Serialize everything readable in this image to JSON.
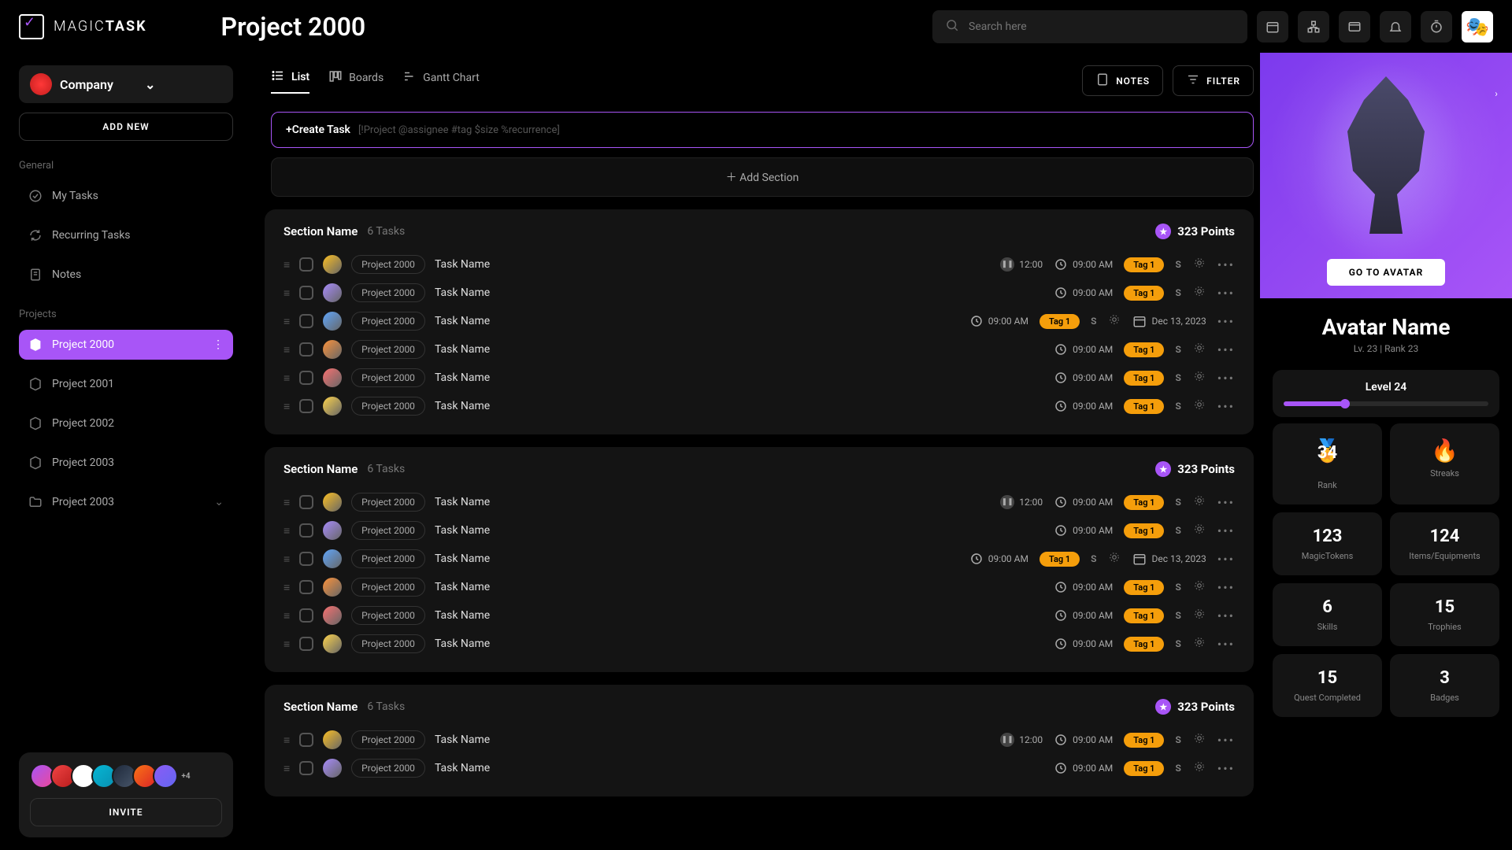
{
  "app_name_light": "MAGIC",
  "app_name_bold": "TASK",
  "page_title": "Project 2000",
  "search_placeholder": "Search here",
  "company_name": "Company",
  "add_new_label": "ADD NEW",
  "sidebar": {
    "general_label": "General",
    "my_tasks": "My Tasks",
    "recurring": "Recurring Tasks",
    "notes": "Notes",
    "projects_label": "Projects",
    "projects": [
      {
        "name": "Project 2000",
        "active": true
      },
      {
        "name": "Project 2001"
      },
      {
        "name": "Project 2002"
      },
      {
        "name": "Project 2003"
      },
      {
        "name": "Project 2003",
        "folder": true
      }
    ],
    "invite_more": "+4",
    "invite_label": "INVITE"
  },
  "tabs": {
    "list": "List",
    "boards": "Boards",
    "gantt": "Gantt Chart",
    "notes_btn": "NOTES",
    "filter_btn": "FILTER"
  },
  "create_task_label": "+Create Task",
  "create_task_hint": "[!Project @assignee #tag $size %recurrence]",
  "add_section_label": "Add Section",
  "section": {
    "name": "Section Name",
    "count": "6 Tasks",
    "points": "323 Points"
  },
  "task": {
    "project": "Project 2000",
    "name": "Task Name",
    "pause_time": "12:00",
    "time": "09:00 AM",
    "tag": "Tag 1",
    "size": "S",
    "date": "Dec 13, 2023"
  },
  "avatar": {
    "go_btn": "GO TO AVATAR",
    "name": "Avatar Name",
    "sub": "Lv. 23 | Rank 23",
    "level": "Level 24",
    "rank_value": "34",
    "rank_label": "Rank",
    "streaks_label": "Streaks",
    "tokens_value": "123",
    "tokens_label": "MagicTokens",
    "items_value": "124",
    "items_label": "Items/Equipments",
    "skills_value": "6",
    "skills_label": "Skills",
    "trophies_value": "15",
    "trophies_label": "Trophies",
    "quests_value": "15",
    "quests_label": "Quest Completed",
    "badges_value": "3",
    "badges_label": "Badges"
  }
}
